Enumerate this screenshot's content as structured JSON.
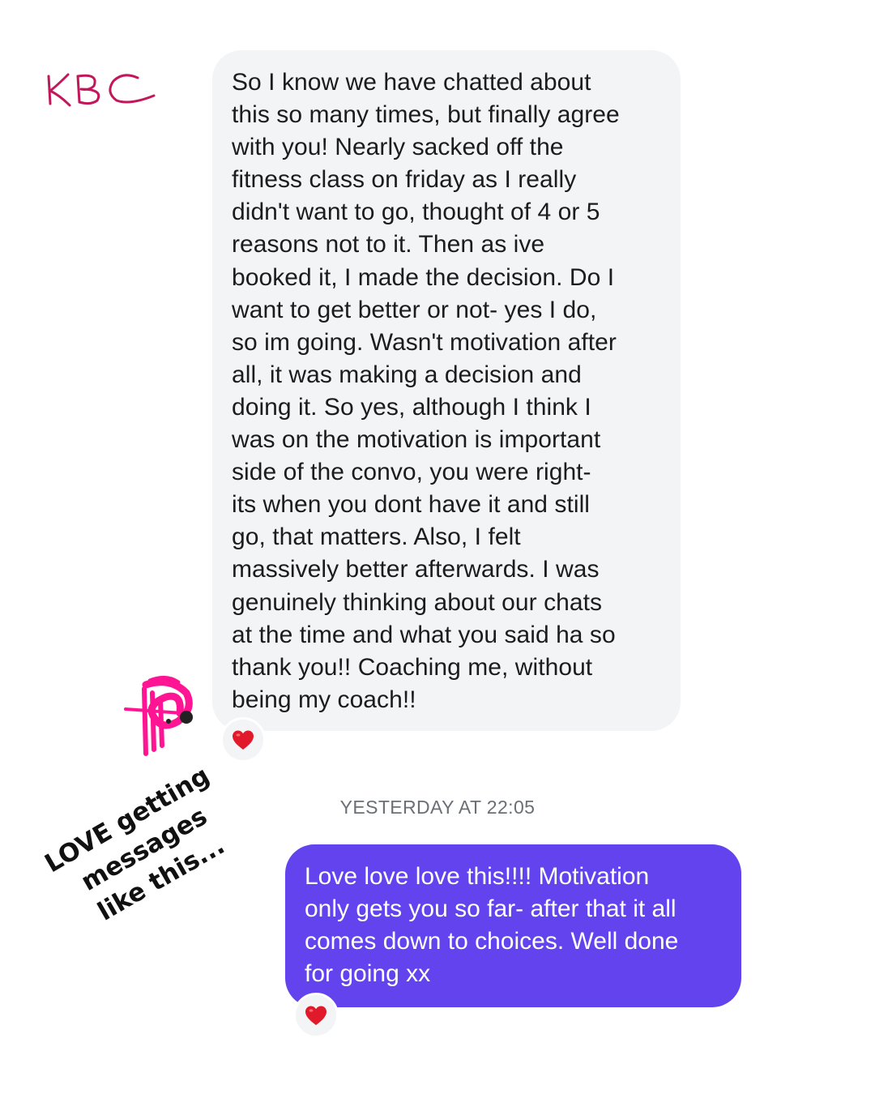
{
  "logo": {
    "text": "KBC",
    "color": "#c2185b"
  },
  "incoming_message": {
    "text": "So I know we have chatted about\nthis so many times, but finally agree\nwith you! Nearly sacked off the\nfitness class on friday as I really\ndidn't want to go, thought of 4 or 5\nreasons not to it. Then as ive\nbooked it, I made the decision. Do I\nwant to get better or not- yes I do,\nso im going. Wasn't motivation after\nall, it was making a decision and\ndoing it. So yes, although I think I\nwas on the motivation is important\nside of the convo, you were right-\nits when you dont have it and still\ngo, that matters. Also, I felt\nmassively better afterwards. I was\ngenuinely thinking about our chats\nat the time and what you said ha so\nthank you!! Coaching me, without\nbeing my coach!!",
    "reaction": "heart-icon",
    "bubble_color": "#f3f4f6"
  },
  "timestamp": "YESTERDAY AT 22:05",
  "outgoing_message": {
    "text": "Love love love this!!!! Motivation\nonly gets you so far- after that it all\ncomes down to choices. Well done\nfor going xx",
    "reaction": "heart-icon",
    "bubble_color": "#6243ee"
  },
  "caption": "LOVE getting\nmessages\nlike this...",
  "colors": {
    "heart": "#e0192b",
    "scribble": "#ff1493"
  }
}
